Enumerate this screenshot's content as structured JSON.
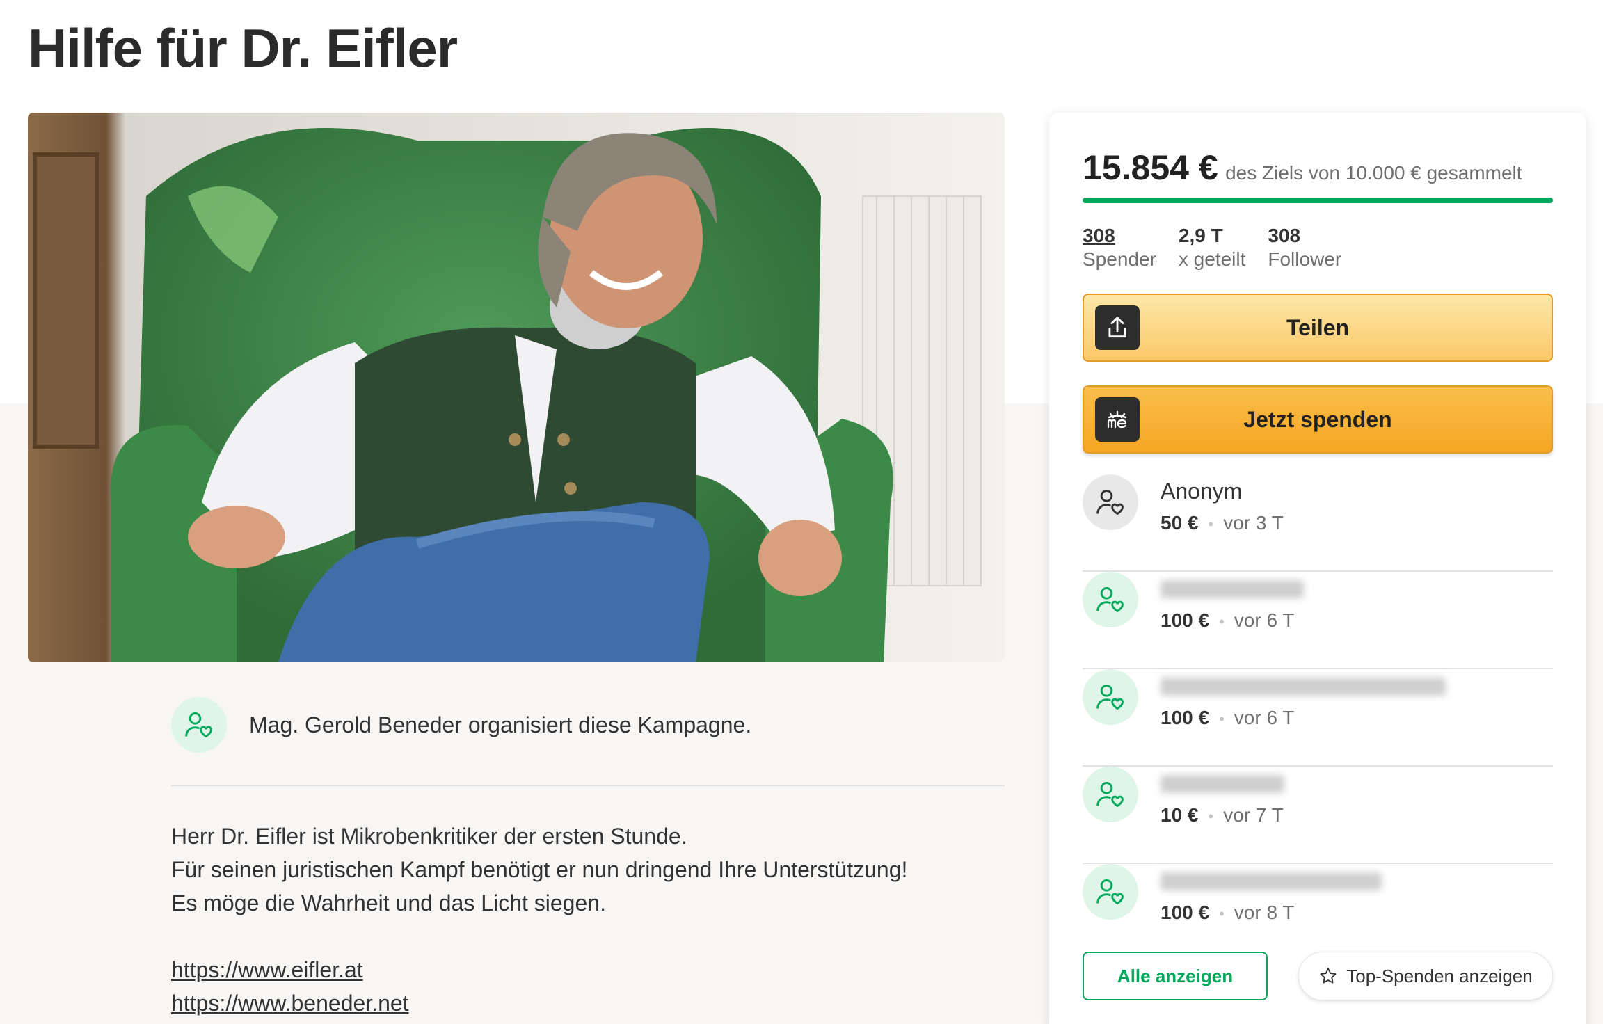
{
  "page": {
    "title": "Hilfe für Dr. Eifler"
  },
  "organizer": {
    "text": "Mag. Gerold Beneder organisiert diese Kampagne."
  },
  "story": {
    "lines": [
      "Herr Dr. Eifler ist Mikrobenkritiker der ersten Stunde.",
      "Für seinen juristischen Kampf benötigt er nun dringend Ihre Unterstützung!",
      "Es möge die Wahrheit und das Licht siegen."
    ],
    "links": [
      "https://www.eifler.at",
      "https://www.beneder.net"
    ]
  },
  "campaign": {
    "raised": "15.854 €",
    "goal_text": "des Ziels von 10.000 € gesammelt",
    "progress_fraction": 1.0,
    "stats": {
      "donors_count": "308",
      "donors_label": "Spender",
      "shares_count": "2,9 T",
      "shares_label": "x geteilt",
      "followers_count": "308",
      "followers_label": "Follower"
    }
  },
  "buttons": {
    "share": "Teilen",
    "donate": "Jetzt spenden",
    "show_all": "Alle anzeigen",
    "top_donations": "Top-Spenden anzeigen"
  },
  "donations": [
    {
      "name": "Anonym",
      "amount": "50 €",
      "time": "vor 3 T"
    },
    {
      "name": "",
      "amount": "100 €",
      "time": "vor 6 T"
    },
    {
      "name": "",
      "amount": "100 €",
      "time": "vor 6 T"
    },
    {
      "name": "",
      "amount": "10 €",
      "time": "vor 7 T"
    },
    {
      "name": "",
      "amount": "100 €",
      "time": "vor 8 T"
    }
  ],
  "colors": {
    "accent_green": "#02a95c",
    "donate_orange": "#f5a623",
    "share_yellow": "#fbc96a"
  },
  "icons": {
    "share": "share-upload-icon",
    "donate": "gofundme-me-icon",
    "donor": "user-heart-icon",
    "star": "star-outline-icon"
  }
}
